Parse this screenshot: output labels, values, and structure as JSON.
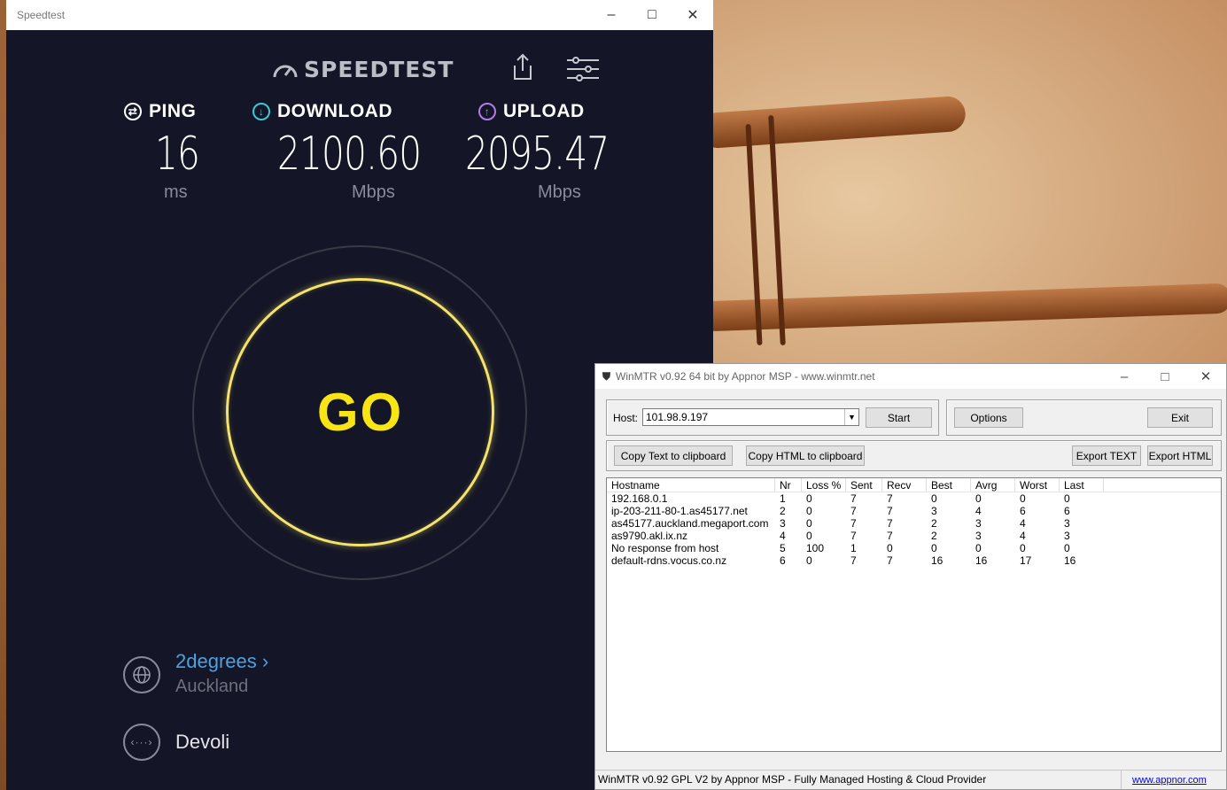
{
  "speedtest": {
    "window_title": "Speedtest",
    "logo_text": "SPEEDTEST",
    "ping": {
      "label": "PING",
      "value": "16",
      "unit": "ms"
    },
    "download": {
      "label": "DOWNLOAD",
      "value": "2100.60",
      "unit": "Mbps"
    },
    "upload": {
      "label": "UPLOAD",
      "value": "2095.47",
      "unit": "Mbps"
    },
    "go_label": "GO",
    "isp": {
      "name": "2degrees",
      "location": "Auckland"
    },
    "server": {
      "name": "Devoli"
    },
    "colors": {
      "background": "#141526",
      "go": "#f8e514",
      "isp_link": "#4aa3e0",
      "download_icon": "#3cc8d8",
      "upload_icon": "#b07ee8"
    }
  },
  "winmtr": {
    "window_title": "WinMTR v0.92 64 bit by Appnor MSP - www.winmtr.net",
    "host_label": "Host:",
    "host_value": "101.98.9.197",
    "buttons": {
      "start": "Start",
      "options": "Options",
      "exit": "Exit",
      "copy_text": "Copy Text to clipboard",
      "copy_html": "Copy HTML to clipboard",
      "export_text": "Export TEXT",
      "export_html": "Export HTML"
    },
    "columns": [
      "Hostname",
      "Nr",
      "Loss %",
      "Sent",
      "Recv",
      "Best",
      "Avrg",
      "Worst",
      "Last"
    ],
    "rows": [
      [
        "192.168.0.1",
        "1",
        "0",
        "7",
        "7",
        "0",
        "0",
        "0",
        "0"
      ],
      [
        "ip-203-211-80-1.as45177.net",
        "2",
        "0",
        "7",
        "7",
        "3",
        "4",
        "6",
        "6"
      ],
      [
        "as45177.auckland.megaport.com",
        "3",
        "0",
        "7",
        "7",
        "2",
        "3",
        "4",
        "3"
      ],
      [
        "as9790.akl.ix.nz",
        "4",
        "0",
        "7",
        "7",
        "2",
        "3",
        "4",
        "3"
      ],
      [
        "No response from host",
        "5",
        "100",
        "1",
        "0",
        "0",
        "0",
        "0",
        "0"
      ],
      [
        "default-rdns.vocus.co.nz",
        "6",
        "0",
        "7",
        "7",
        "16",
        "16",
        "17",
        "16"
      ]
    ],
    "status_text": "WinMTR v0.92 GPL V2 by Appnor MSP - Fully Managed Hosting & Cloud Provider",
    "status_link": "www.appnor.com"
  }
}
